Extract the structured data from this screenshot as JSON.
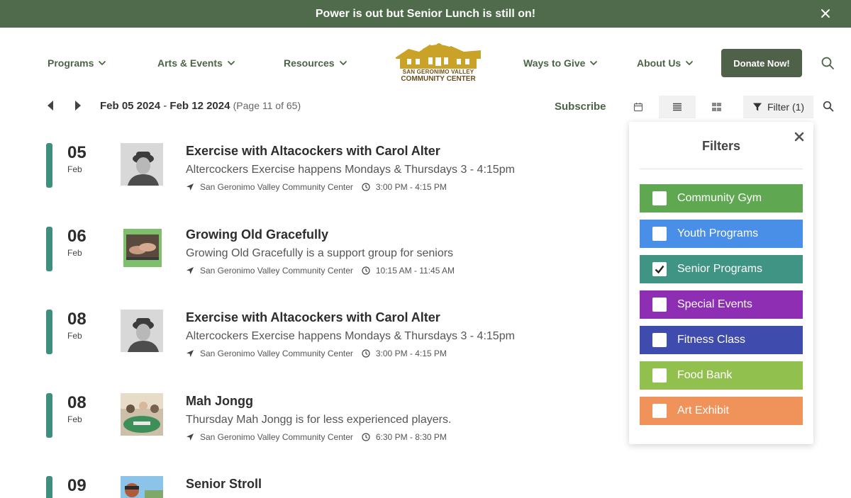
{
  "announcement": {
    "text": "Power is out but Senior Lunch is still on!"
  },
  "nav": {
    "items": [
      {
        "label": "Programs"
      },
      {
        "label": "Arts & Events"
      },
      {
        "label": "Resources"
      },
      {
        "label": "Ways to Give"
      },
      {
        "label": "About Us"
      }
    ],
    "logo_line1": "SAN GERONIMO VALLEY",
    "logo_line2": "COMMUNITY CENTER",
    "donate_label": "Donate Now!"
  },
  "toolbar": {
    "range_start": "Feb 05 2024",
    "range_sep": " - ",
    "range_end": "Feb 12 2024",
    "page_info": "(Page 11 of 65)",
    "subscribe_label": "Subscribe",
    "filter_label": "Filter (1)"
  },
  "events": [
    {
      "day": "05",
      "month": "Feb",
      "title": "Exercise with Altacockers with Carol Alter",
      "description": "Altercockers Exercise happens Mondays & Thursdays 3 - 4:15pm",
      "location": "San Geronimo Valley Community Center",
      "time": "3:00 PM - 4:15 PM"
    },
    {
      "day": "06",
      "month": "Feb",
      "title": "Growing Old Gracefully",
      "description": "Growing Old Gracefully is a support group for seniors",
      "location": "San Geronimo Valley Community Center",
      "time": "10:15 AM - 11:45 AM"
    },
    {
      "day": "08",
      "month": "Feb",
      "title": "Exercise with Altacockers with Carol Alter",
      "description": "Altercockers Exercise happens Mondays & Thursdays 3 - 4:15pm",
      "location": "San Geronimo Valley Community Center",
      "time": "3:00 PM - 4:15 PM"
    },
    {
      "day": "08",
      "month": "Feb",
      "title": "Mah Jongg",
      "description": "Thursday Mah Jongg is for less experienced players.",
      "location": "San Geronimo Valley Community Center",
      "time": "6:30 PM - 8:30 PM"
    },
    {
      "day": "09",
      "month": "",
      "title": "Senior Stroll",
      "description": "",
      "location": "",
      "time": ""
    }
  ],
  "filters": {
    "title": "Filters",
    "options": [
      {
        "label": "Community Gym",
        "color": "#5fa851",
        "checked": false
      },
      {
        "label": "Youth Programs",
        "color": "#4a8fe7",
        "checked": false
      },
      {
        "label": "Senior Programs",
        "color": "#3f9484",
        "checked": true
      },
      {
        "label": "Special Events",
        "color": "#8e2fb3",
        "checked": false
      },
      {
        "label": "Fitness Class",
        "color": "#3f4cad",
        "checked": false
      },
      {
        "label": "Food Bank",
        "color": "#92c04f",
        "checked": false
      },
      {
        "label": "Art Exhibit",
        "color": "#f0935a",
        "checked": false
      }
    ]
  }
}
